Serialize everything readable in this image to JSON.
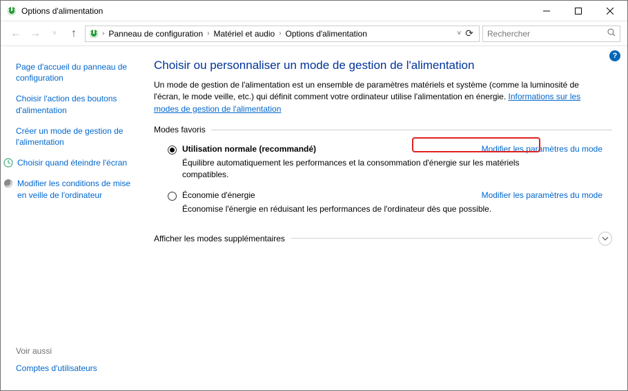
{
  "window": {
    "title": "Options d'alimentation"
  },
  "breadcrumb": {
    "items": [
      "Panneau de configuration",
      "Matériel et audio",
      "Options d'alimentation"
    ]
  },
  "search": {
    "placeholder": "Rechercher"
  },
  "sidebar": {
    "links": [
      "Page d'accueil du panneau de configuration",
      "Choisir l'action des boutons d'alimentation",
      "Créer un mode de gestion de l'alimentation",
      "Choisir quand éteindre l'écran",
      "Modifier les conditions de mise en veille de l'ordinateur"
    ],
    "see_also_label": "Voir aussi",
    "see_also_links": [
      "Comptes d'utilisateurs"
    ]
  },
  "main": {
    "heading": "Choisir ou personnaliser un mode de gestion de l'alimentation",
    "intro_prefix": "Un mode de gestion de l'alimentation est un ensemble de paramètres matériels et système (comme la luminosité de l'écran, le mode veille, etc.) qui définit comment votre ordinateur utilise l'alimentation en énergie. ",
    "intro_link": "Informations sur les modes de gestion de l'alimentation",
    "group_preferred_label": "Modes favoris",
    "group_additional_label": "Afficher les modes supplémentaires",
    "modify_link_text": "Modifier les paramètres du mode",
    "plans": [
      {
        "name": "Utilisation normale (recommandé)",
        "selected": true,
        "desc": "Équilibre automatiquement les performances et la consommation d'énergie sur les matériels compatibles."
      },
      {
        "name": "Économie d'énergie",
        "selected": false,
        "desc": "Économise l'énergie en réduisant les performances de l'ordinateur dès que possible."
      }
    ]
  }
}
